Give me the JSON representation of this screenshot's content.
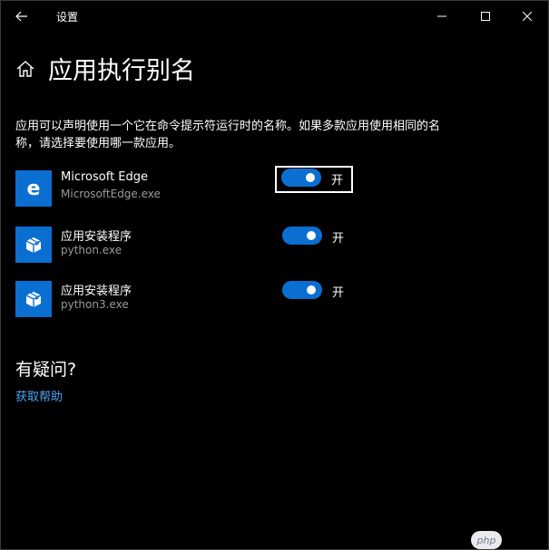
{
  "window": {
    "title": "设置"
  },
  "header": {
    "title": "应用执行别名"
  },
  "description": "应用可以声明使用一个它在命令提示符运行时的名称。如果多款应用使用相同的名称，请选择要使用哪一款应用。",
  "apps": [
    {
      "name": "Microsoft Edge",
      "exe": "MicrosoftEdge.exe",
      "toggle_state": "开",
      "enabled": true,
      "icon": "edge-icon",
      "focused": true
    },
    {
      "name": "应用安装程序",
      "exe": "python.exe",
      "toggle_state": "开",
      "enabled": true,
      "icon": "app-installer-icon",
      "focused": false
    },
    {
      "name": "应用安装程序",
      "exe": "python3.exe",
      "toggle_state": "开",
      "enabled": true,
      "icon": "app-installer-icon",
      "focused": false
    }
  ],
  "help": {
    "heading": "有疑问?",
    "link": "获取帮助"
  },
  "watermark": "php",
  "colors": {
    "background": "#000000",
    "accent": "#0a6fd1",
    "link": "#4ca5f5",
    "secondary_text": "#9a9a9a"
  }
}
